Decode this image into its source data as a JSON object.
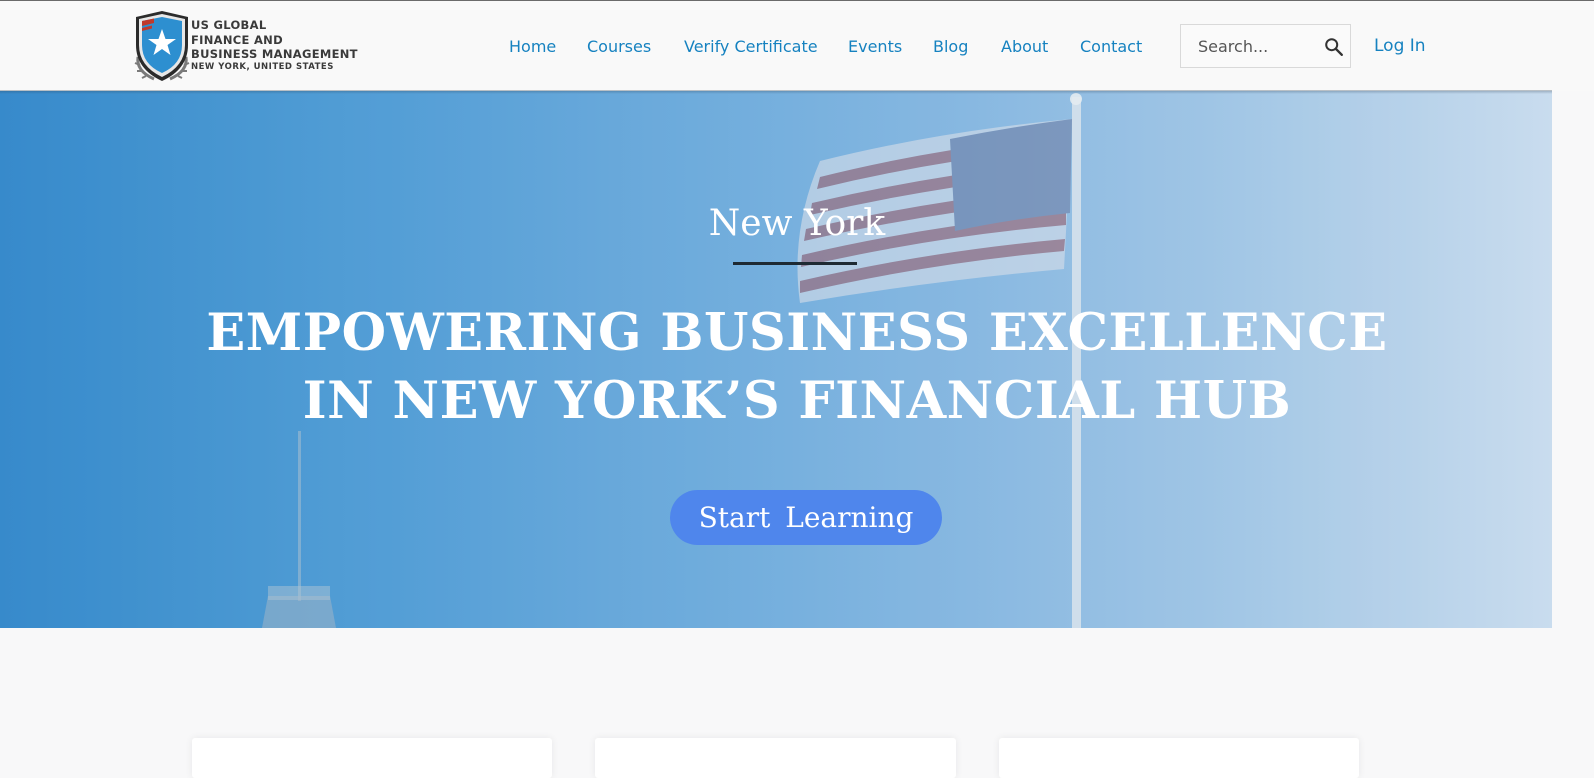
{
  "brand": {
    "line1": "US GLOBAL",
    "line2": "FINANCE AND",
    "line3": "BUSINESS MANAGEMENT",
    "line4": "NEW YORK, UNITED STATES"
  },
  "nav": {
    "items": [
      {
        "label": "Home"
      },
      {
        "label": "Courses"
      },
      {
        "label": "Verify Certificate"
      },
      {
        "label": "Events"
      },
      {
        "label": "Blog"
      },
      {
        "label": "About"
      },
      {
        "label": "Contact"
      }
    ]
  },
  "search": {
    "placeholder": "Search...",
    "value": "",
    "icon": "search-icon"
  },
  "login": {
    "label": "Log In"
  },
  "hero": {
    "subtitle": "New York",
    "title_line1": "EMPOWERING BUSINESS EXCELLENCE",
    "title_line2": "IN NEW YORK’S FINANCIAL HUB",
    "cta": "Start  Learning"
  },
  "colors": {
    "link": "#1682c0",
    "cta": "#4f86ec",
    "hero_left": "#2f86c9",
    "hero_right": "#c7dbee",
    "page_bg": "#f8f8f9"
  }
}
